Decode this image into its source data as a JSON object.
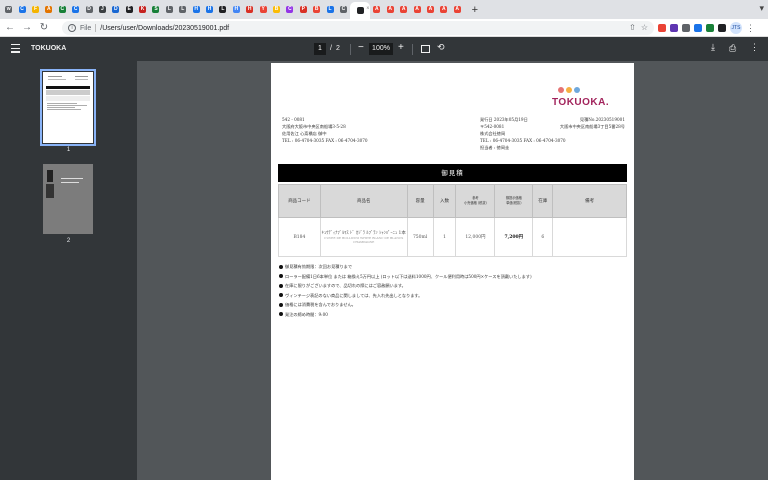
{
  "browser": {
    "tabs": [
      {
        "icon": "chrome-icon",
        "color": "#5f6368",
        "text": "w"
      },
      {
        "icon": "c-icon",
        "color": "#1a73e8",
        "text": "C"
      },
      {
        "icon": "f-icon",
        "color": "#f4b400",
        "text": "F"
      },
      {
        "icon": "a-icon",
        "color": "#e37400",
        "text": "A"
      },
      {
        "icon": "x-icon",
        "color": "#188038",
        "text": "C"
      },
      {
        "icon": "c-icon",
        "color": "#1a73e8",
        "text": "C"
      },
      {
        "icon": "d-icon",
        "color": "#5f6368",
        "text": "D"
      },
      {
        "icon": "j-icon",
        "color": "#3c4043",
        "text": "J"
      },
      {
        "icon": "d-icon",
        "color": "#1967d2",
        "text": "D"
      },
      {
        "icon": "e-icon",
        "color": "#202124",
        "text": "E"
      },
      {
        "icon": "k-icon",
        "color": "#c5221f",
        "text": "K"
      },
      {
        "icon": "s-icon",
        "color": "#188038",
        "text": "S"
      },
      {
        "icon": "l-icon",
        "color": "#5f6368",
        "text": "L"
      },
      {
        "icon": "l-icon",
        "color": "#5f6368",
        "text": "L"
      },
      {
        "icon": "h-icon",
        "color": "#1a73e8",
        "text": "H"
      },
      {
        "icon": "h-icon",
        "color": "#1a73e8",
        "text": "H"
      },
      {
        "icon": "l-icon",
        "color": "#202124",
        "text": "L"
      },
      {
        "icon": "h-icon",
        "color": "#4285f4",
        "text": "H"
      },
      {
        "icon": "h-icon",
        "color": "#d93025",
        "text": "H"
      },
      {
        "icon": "y-icon",
        "color": "#ea4335",
        "text": "Y"
      },
      {
        "icon": "b-icon",
        "color": "#fbbc04",
        "text": "B"
      },
      {
        "icon": "c-icon",
        "color": "#9334e6",
        "text": "C"
      },
      {
        "icon": "p-icon",
        "color": "#d93025",
        "text": "P"
      },
      {
        "icon": "b-icon",
        "color": "#ea4335",
        "text": "B"
      },
      {
        "icon": "l-icon",
        "color": "#1a73e8",
        "text": "L"
      },
      {
        "icon": "c-icon",
        "color": "#5f6368",
        "text": "C"
      }
    ],
    "active_tab_text": "X",
    "right_tabs": [
      {
        "icon": "a-icon",
        "color": "#ea4335",
        "text": "A"
      },
      {
        "icon": "a-icon",
        "color": "#ea4335",
        "text": "A"
      },
      {
        "icon": "a-icon",
        "color": "#ea4335",
        "text": "A"
      },
      {
        "icon": "a-icon",
        "color": "#ea4335",
        "text": "A"
      },
      {
        "icon": "a-icon",
        "color": "#ea4335",
        "text": "A"
      },
      {
        "icon": "a-icon",
        "color": "#ea4335",
        "text": "A"
      },
      {
        "icon": "a-icon",
        "color": "#ea4335",
        "text": "A"
      }
    ],
    "new_tab_label": "+",
    "address": {
      "scheme_label": "File",
      "url": "/Users/user/Downloads/20230519001.pdf"
    },
    "profile_label": "JTS",
    "extensions": [
      "#ea4335",
      "#5e35b1",
      "#5f6368",
      "#1a73e8",
      "#188038",
      "#202124"
    ]
  },
  "viewer": {
    "title": "TOKUOKA",
    "current_page": "1",
    "page_separator": "/",
    "total_pages": "2",
    "zoom": "100%",
    "thumbnails": [
      {
        "label": "1"
      },
      {
        "label": "2"
      }
    ]
  },
  "document": {
    "logo_text": "TOKUOKA.",
    "logo_colors": [
      "#e57373",
      "#f6b042",
      "#6fa8dc"
    ],
    "brand_color": "#a2245c",
    "sender": {
      "postal": "542 - 0081",
      "address": "大阪府大阪市中央区南船場3-5-28",
      "company": "佐用佐江 心斎橋店 御中",
      "tel": "TEL : 06-4704-3035 FAX : 06-4704-3070"
    },
    "issuer": {
      "issue_date": "発行日 2023年05月19日",
      "quote_no": "見積No.20230519001",
      "postal": "〒542-0081",
      "address": "大阪市中央区南船場3丁目5番28号",
      "company": "株式会社徳岡",
      "tel": "TEL : 06-4704-3035 FAX : 06-4704-3070",
      "person": "担当者 : 徳岡圭"
    },
    "banner": "御見積",
    "table": {
      "headers": [
        {
          "main": "商品コード",
          "small": ""
        },
        {
          "main": "商品名",
          "small": ""
        },
        {
          "main": "容量",
          "small": ""
        },
        {
          "main": "入数",
          "small": ""
        },
        {
          "main": "参考",
          "small": "小売価格 (税抜)"
        },
        {
          "main": "御提示価格",
          "small": "単価(税抜)"
        },
        {
          "main": "在庫",
          "small": ""
        },
        {
          "main": "備考",
          "small": ""
        }
      ],
      "rows": [
        {
          "code": "B184",
          "name": "ｷｭｳﾃﾞｨﾅﾌﾞﾙﾏｽ ﾄﾞ ｶｼﾞﾗ ﾙﾌﾞﾗﾝ ｼｬﾝﾊﾟｰﾆｭ 1本",
          "name_sub": "CUVEE DE BOLLICINI WHITE BLANC DE BLANCS CHAMPAGNE",
          "volume": "750ml",
          "qty": "1",
          "retail": "12,000円",
          "price": "7,200円",
          "stock": "6",
          "note": ""
        }
      ]
    },
    "notes": [
      "御見積有効期限：次回お見積りまで",
      "ローラー配備1日6本単位 または 箱換え5万円以上 (ロット以下は送料1000円、クール便利用時は500円×ケースを頂戴いたします)",
      "在庫に限りがございますので、品切れの際にはご容赦願います。",
      "ヴィンテージ表記のない商品に関しましては、先入れ先出しとなります。",
      "価格には消費税を含んでおりません。",
      "発注の締め時間：9:00"
    ]
  }
}
